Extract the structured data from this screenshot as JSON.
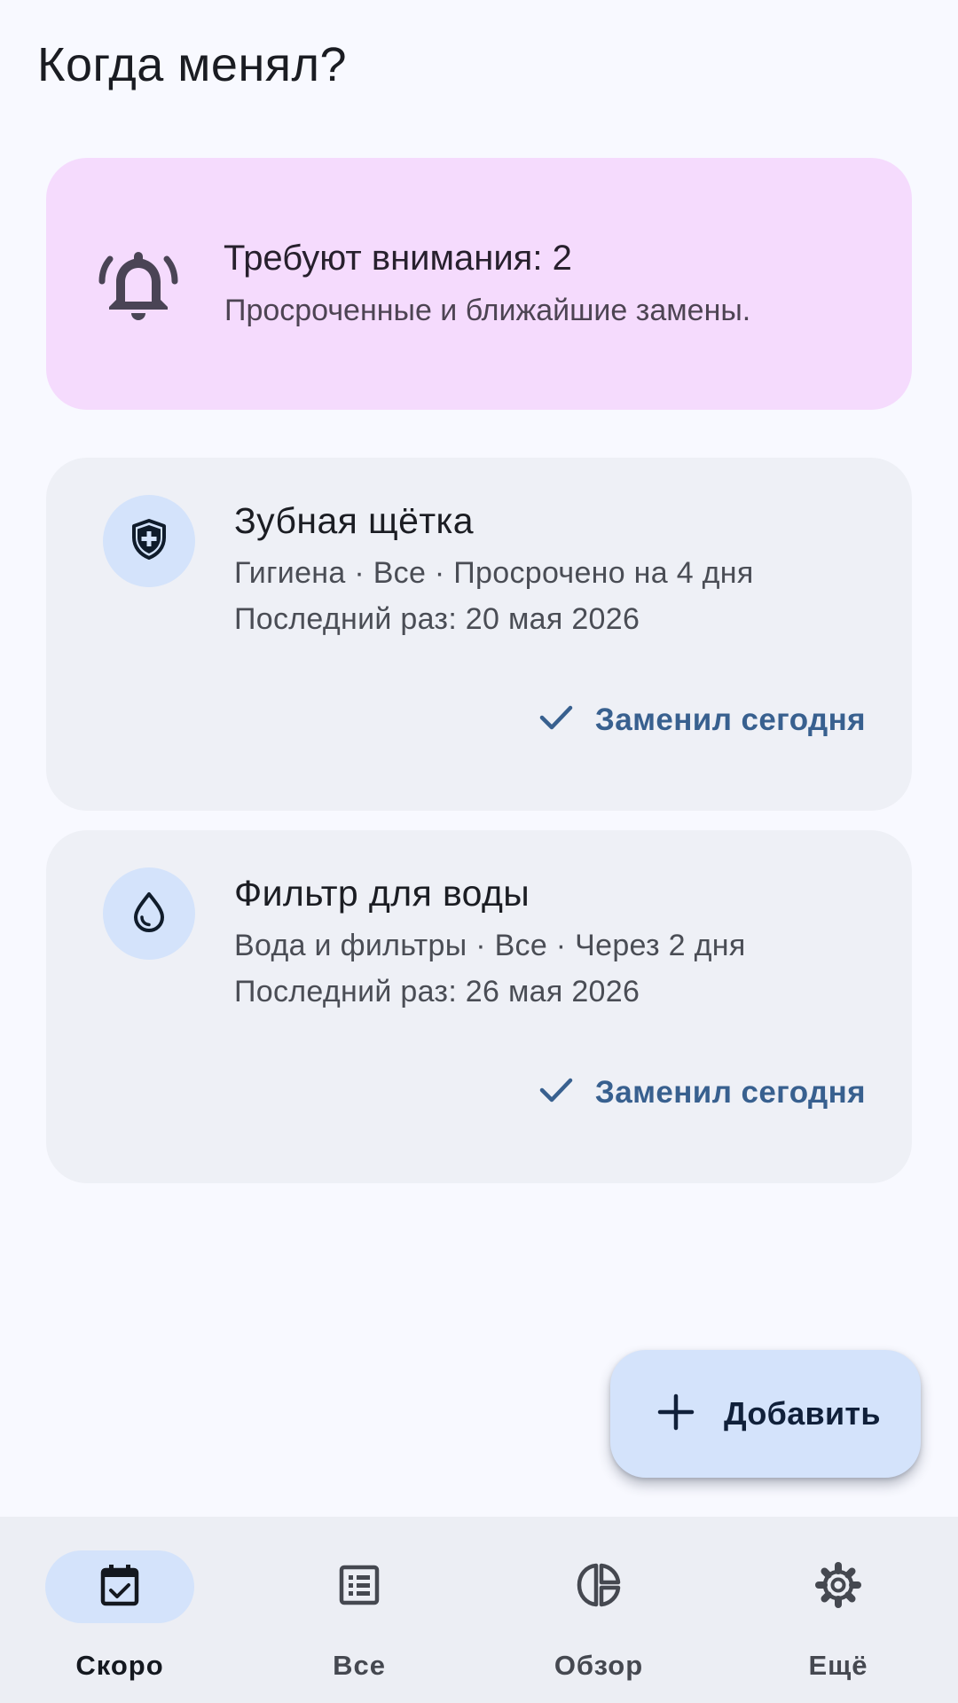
{
  "app": {
    "title": "Когда менял?"
  },
  "alert": {
    "title": "Требуют внимания: 2",
    "subtitle": "Просроченные и ближайшие замены.",
    "icon": "bell-ring-icon"
  },
  "items": [
    {
      "icon": "shield-plus-icon",
      "title": "Зубная щётка",
      "meta": "Гигиена · Все · Просрочено на 4 дня",
      "last": "Последний раз: 20 мая 2026",
      "action": "Заменил сегодня"
    },
    {
      "icon": "water-drop-icon",
      "title": "Фильтр для воды",
      "meta": "Вода и фильтры · Все · Через 2 дня",
      "last": "Последний раз: 26 мая 2026",
      "action": "Заменил сегодня"
    }
  ],
  "fab": {
    "label": "Добавить",
    "icon": "plus-icon"
  },
  "nav": {
    "items": [
      {
        "label": "Скоро",
        "icon": "calendar-check-icon",
        "active": true
      },
      {
        "label": "Все",
        "icon": "list-icon",
        "active": false
      },
      {
        "label": "Обзор",
        "icon": "pie-chart-icon",
        "active": false
      },
      {
        "label": "Ещё",
        "icon": "gear-icon",
        "active": false
      }
    ]
  },
  "colors": {
    "background": "#f8f9ff",
    "alert_bg": "#f5dbfd",
    "card_bg": "#eef0f6",
    "accent_container": "#d4e3fb",
    "action_text": "#38608f"
  }
}
